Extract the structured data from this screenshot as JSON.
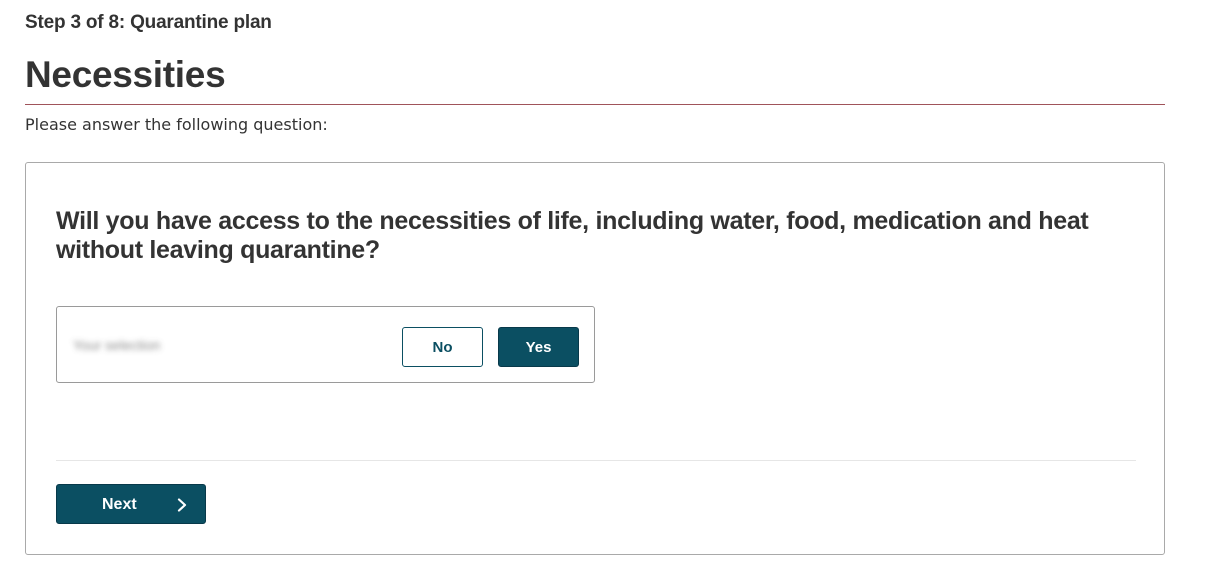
{
  "header": {
    "step": "Step 3 of 8: Quarantine plan",
    "title": "Necessities",
    "instruction": "Please answer the following question:"
  },
  "question": {
    "text": "Will you have access to the necessities of life, including water, food, medication and heat without leaving quarantine?",
    "answer_label": "Your selection",
    "options": {
      "no": "No",
      "yes": "Yes"
    },
    "selected": "Yes"
  },
  "footer": {
    "next_label": "Next",
    "next_icon": "chevron-right-icon"
  },
  "colors": {
    "primary": "#0b4f62",
    "title_rule": "#a0535a",
    "text": "#333333"
  }
}
